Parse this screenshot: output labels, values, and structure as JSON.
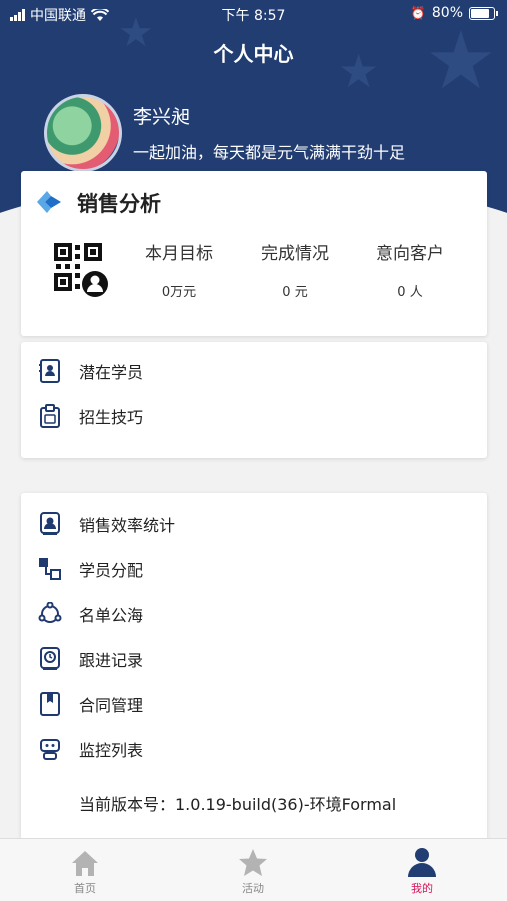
{
  "status_bar": {
    "carrier": "中国联通",
    "time": "下午 8:57",
    "battery": "80%",
    "battery_level": 0.8
  },
  "header": {
    "title": "个人中心"
  },
  "profile": {
    "name": "李兴昶",
    "motto": "一起加油，每天都是元气满满干劲十足"
  },
  "sales": {
    "title": "销售分析",
    "stats": [
      {
        "label": "本月目标",
        "value": "0万元"
      },
      {
        "label": "完成情况",
        "value": "0 元"
      },
      {
        "label": "意向客户",
        "value": "0 人"
      }
    ]
  },
  "group1": [
    {
      "label": "潜在学员",
      "icon": "contact-card-icon"
    },
    {
      "label": "招生技巧",
      "icon": "clipboard-icon"
    }
  ],
  "group2": [
    {
      "label": "销售效率统计",
      "icon": "profile-badge-icon"
    },
    {
      "label": "学员分配",
      "icon": "assign-icon"
    },
    {
      "label": "名单公海",
      "icon": "network-icon"
    },
    {
      "label": "跟进记录",
      "icon": "record-icon"
    },
    {
      "label": "合同管理",
      "icon": "contract-icon"
    },
    {
      "label": "监控列表",
      "icon": "monitor-robot-icon"
    }
  ],
  "version": "当前版本号：1.0.19-build(36)-环境Formal",
  "tabs": [
    {
      "label": "首页",
      "icon": "home-icon",
      "active": false
    },
    {
      "label": "活动",
      "icon": "star-icon",
      "active": false
    },
    {
      "label": "我的",
      "icon": "person-icon",
      "active": true
    }
  ],
  "colors": {
    "header": "#213d72",
    "active_tab": "#d4145a",
    "accent_icon": "#1f3a6e"
  }
}
